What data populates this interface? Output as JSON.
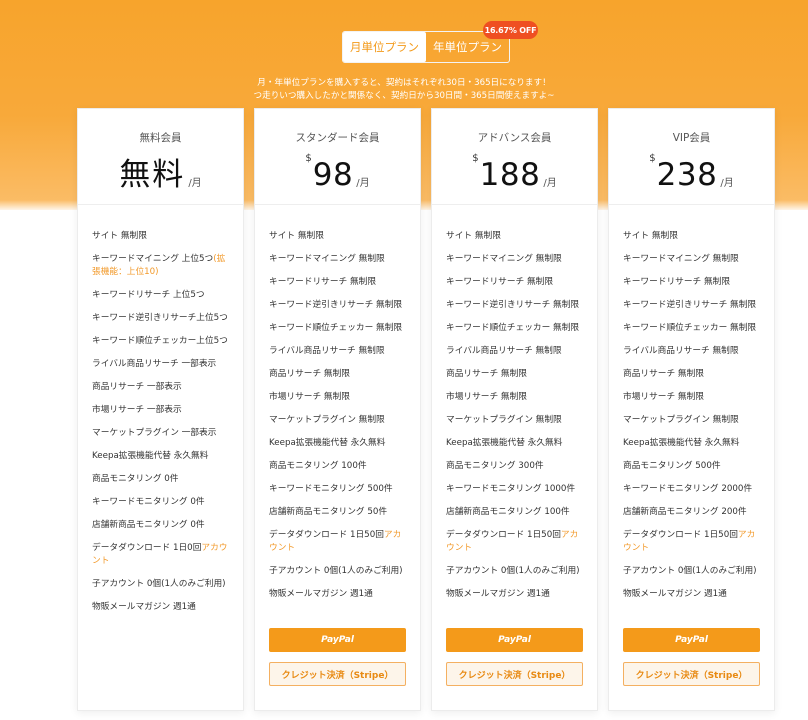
{
  "toggle": {
    "monthly_label": "月単位プラン",
    "yearly_label": "年単位プラン",
    "discount_badge": "16.67% OFF"
  },
  "notice": {
    "line1": "月・年単位プランを購入すると、契約はそれぞれ30日・365日になります！",
    "line2": "つ走りいつ購入したかと関係なく、契約日から30日間・365日間使えますよ~"
  },
  "colors": {
    "accent": "#f49a1a",
    "highlight_text": "#f29a2b",
    "badge": "#ef4f22"
  },
  "plans": [
    {
      "name": "無料会員",
      "currency": "",
      "price": "無料",
      "per": "/月",
      "features": [
        "サイト 無制限",
        "キーワードマイニング 上位5つ",
        "(拡張機能：上位10)",
        "キーワードリサーチ 上位5つ",
        "キーワード逆引きリサーチ上位5つ",
        "キーワード順位チェッカー上位5つ",
        "ライバル商品リサーチ 一部表示",
        "商品リサーチ 一部表示",
        "市場リサーチ 一部表示",
        "マーケットプラグイン 一部表示",
        "Keepa拡張機能代替 永久無料",
        "商品モニタリング 0件",
        "キーワードモニタリング 0件",
        "店舗新商品モニタリング 0件",
        "データダウンロード 1日0回",
        "アカウント",
        "子アカウント 0個(1人のみご利用)",
        "物販メールマガジン 週1通"
      ]
    },
    {
      "name": "スタンダード会員",
      "currency": "$",
      "price": "98",
      "per": "/月",
      "features": [
        "サイト 無制限",
        "キーワードマイニング 無制限",
        "キーワードリサーチ 無制限",
        "キーワード逆引きリサーチ 無制限",
        "キーワード順位チェッカー 無制限",
        "ライバル商品リサーチ 無制限",
        "商品リサーチ 無制限",
        "市場リサーチ 無制限",
        "マーケットプラグイン 無制限",
        "Keepa拡張機能代替 永久無料",
        "商品モニタリング 100件",
        "キーワードモニタリング 500件",
        "店舗新商品モニタリング 50件",
        "データダウンロード 1日50回",
        "アカウント",
        "子アカウント 0個(1人のみご利用)",
        "物販メールマガジン 週1通"
      ],
      "paypal_label": "PayPal",
      "stripe_label": "クレジット決済（Stripe）"
    },
    {
      "name": "アドバンス会員",
      "currency": "$",
      "price": "188",
      "per": "/月",
      "features": [
        "サイト 無制限",
        "キーワードマイニング 無制限",
        "キーワードリサーチ 無制限",
        "キーワード逆引きリサーチ 無制限",
        "キーワード順位チェッカー 無制限",
        "ライバル商品リサーチ 無制限",
        "商品リサーチ 無制限",
        "市場リサーチ 無制限",
        "マーケットプラグイン 無制限",
        "Keepa拡張機能代替 永久無料",
        "商品モニタリング 300件",
        "キーワードモニタリング 1000件",
        "店舗新商品モニタリング 100件",
        "データダウンロード 1日50回",
        "アカウント",
        "子アカウント 0個(1人のみご利用)",
        "物販メールマガジン 週1通"
      ],
      "paypal_label": "PayPal",
      "stripe_label": "クレジット決済（Stripe）"
    },
    {
      "name": "VIP会員",
      "currency": "$",
      "price": "238",
      "per": "/月",
      "features": [
        "サイト 無制限",
        "キーワードマイニング 無制限",
        "キーワードリサーチ 無制限",
        "キーワード逆引きリサーチ 無制限",
        "キーワード順位チェッカー 無制限",
        "ライバル商品リサーチ 無制限",
        "商品リサーチ 無制限",
        "市場リサーチ 無制限",
        "マーケットプラグイン 無制限",
        "Keepa拡張機能代替 永久無料",
        "商品モニタリング 500件",
        "キーワードモニタリング 2000件",
        "店舗新商品モニタリング 200件",
        "データダウンロード 1日50回",
        "アカウント",
        "子アカウント 0個(1人のみご利用)",
        "物販メールマガジン 週1通"
      ],
      "paypal_label": "PayPal",
      "stripe_label": "クレジット決済（Stripe）"
    }
  ]
}
